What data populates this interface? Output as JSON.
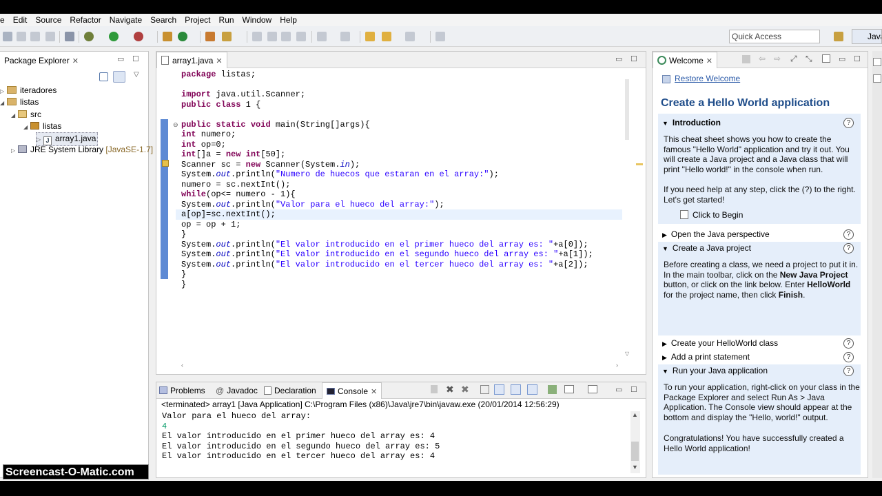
{
  "menu": [
    "e",
    "Edit",
    "Source",
    "Refactor",
    "Navigate",
    "Search",
    "Project",
    "Run",
    "Window",
    "Help"
  ],
  "quick_access": "Quick Access",
  "perspective_label": "Java",
  "package_explorer": {
    "title": "Package Explorer",
    "items": [
      {
        "label": "iteradores",
        "depth": 0,
        "fold": "▷"
      },
      {
        "label": "listas",
        "depth": 0,
        "fold": "◢"
      },
      {
        "label": "src",
        "depth": 1,
        "fold": "◢"
      },
      {
        "label": "listas",
        "depth": 2,
        "fold": "◢"
      },
      {
        "label": "array1.java",
        "depth": 3,
        "fold": "▷"
      },
      {
        "label": "JRE System Library",
        "depth": 1,
        "fold": "▷",
        "suffix": "[JavaSE-1.7]"
      }
    ]
  },
  "editor": {
    "tab": "array1.java",
    "lines": [
      "package listas;",
      "",
      "import java.util.Scanner;",
      "public class array1 {",
      "",
      "public static void main(String[]args){",
      "int numero;",
      "int op=0;",
      "int[]a = new int[50];",
      "Scanner sc = new Scanner(System.in);",
      "System.out.println(\"Numero de huecos que estaran en el array:\");",
      "numero = sc.nextInt();",
      "while(op<= numero - 1){",
      "System.out.println(\"Valor para el hueco del array:\");",
      "a[op]=sc.nextInt();",
      "op = op + 1;",
      "}",
      "System.out.println(\"El valor introducido en el primer hueco del array es: \"+a[0]);",
      "System.out.println(\"El valor introducido en el segundo hueco del array es: \"+a[1]);",
      "System.out.println(\"El valor introducido en el tercer hueco del array es: \"+a[2]);",
      "}",
      "}"
    ]
  },
  "bottom": {
    "tabs": [
      "Problems",
      "Javadoc",
      "Declaration",
      "Console"
    ],
    "status": "<terminated> array1 [Java Application] C:\\Program Files (x86)\\Java\\jre7\\bin\\javaw.exe (20/01/2014 12:56:29)",
    "output": [
      {
        "text": "Valor para el hueco del array:",
        "color": "#000000"
      },
      {
        "text": "4",
        "color": "#009966"
      },
      {
        "text": "El valor introducido en el primer hueco del array es: 4",
        "color": "#000000"
      },
      {
        "text": "El valor introducido en el segundo hueco del array es: 5",
        "color": "#000000"
      },
      {
        "text": "El valor introducido en el tercer hueco del array es: 4",
        "color": "#000000"
      }
    ]
  },
  "welcome": {
    "tab": "Welcome",
    "restore": "Restore Welcome",
    "heading": "Create a Hello World application",
    "intro_title": "Introduction",
    "intro_p1": "This cheat sheet shows you how to create the famous \"Hello World\" application and try it out. You will create a Java project and a Java class that will print \"Hello world!\" in the console when run.",
    "intro_p2": "If you need help at any step, click the (?) to the right. Let's get started!",
    "click_to_begin": "Click to Begin",
    "sec_open": "Open the Java perspective",
    "sec_create": "Create a Java project",
    "create_p_pre": "Before creating a class, we need a project to put it in. In the main toolbar, click on the ",
    "create_p_b1": "New Java Project",
    "create_p_mid": " button, or click on the link below. Enter ",
    "create_p_b2": "HelloWorld",
    "create_p_mid2": " for the project name, then click ",
    "create_p_b3": "Finish",
    "create_p_end": ".",
    "sec_class": "Create your HelloWorld class",
    "sec_print": "Add a print statement",
    "sec_run": "Run your Java application",
    "run_p": "To run your application, right-click on your class in the Package Explorer and select Run As > Java Application. The Console view should appear at the bottom and display the \"Hello, world!\" output.",
    "congrats": "Congratulations! You have successfully created a Hello World application!"
  },
  "watermark": "Screencast-O-Matic.com"
}
